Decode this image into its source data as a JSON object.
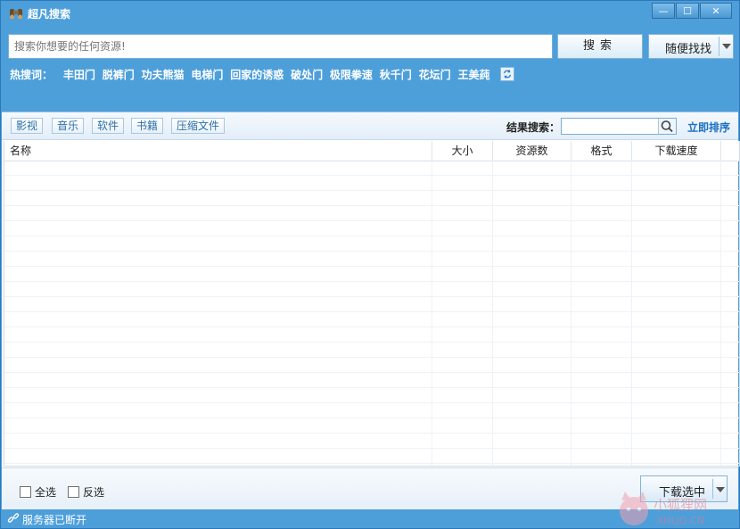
{
  "window": {
    "title": "超凡搜索",
    "controls": {
      "minimize": "—",
      "restore": "☐",
      "close": "✕"
    }
  },
  "search": {
    "placeholder": "搜索你想要的任何资源!",
    "value": "",
    "search_button": "搜索",
    "random_button": "随便找找"
  },
  "hot_words": {
    "label": "热搜词：",
    "items": [
      "丰田门",
      "脱裤门",
      "功夫熊猫",
      "电梯门",
      "回家的诱惑",
      "破处门",
      "极限拳速",
      "秋千门",
      "花坛门",
      "王美莼"
    ]
  },
  "categories": [
    "影视",
    "音乐",
    "软件",
    "书籍",
    "压缩文件"
  ],
  "result_search": {
    "label": "结果搜索：",
    "value": "",
    "sort_link": "立即排序"
  },
  "table": {
    "columns": [
      "名称",
      "大小",
      "资源数",
      "格式",
      "下载速度"
    ],
    "rows": []
  },
  "footer": {
    "select_all": "全选",
    "invert_select": "反选",
    "download_button": "下载选中"
  },
  "status": {
    "text": "服务器已断开"
  },
  "watermark": {
    "text": "小狐狸网",
    "sub": "XHLJG.CN"
  },
  "colors": {
    "chrome": "#4d9fda",
    "link": "#1a6fc4",
    "accent_text": "#2d6fa8"
  }
}
